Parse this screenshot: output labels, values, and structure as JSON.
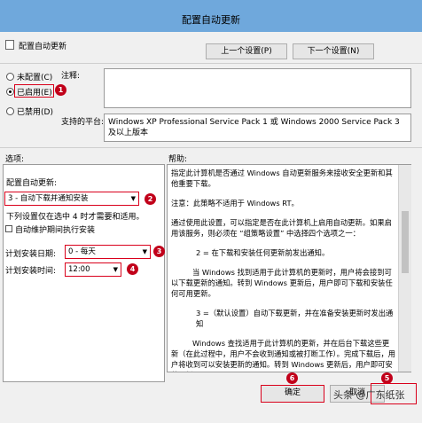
{
  "window": {
    "title": "配置自动更新"
  },
  "header": {
    "policy_name": "配置自动更新",
    "prev_button": "上一个设置(P)",
    "next_button": "下一个设置(N)"
  },
  "state": {
    "options": [
      {
        "label": "未配置(C)",
        "selected": false
      },
      {
        "label": "已启用(E)",
        "selected": true
      },
      {
        "label": "已禁用(D)",
        "selected": false
      }
    ],
    "comment_label": "注释:",
    "platform_label": "支持的平台:",
    "platform_text": "Windows XP Professional Service Pack 1 或 Windows 2000 Service Pack 3 及以上版本"
  },
  "sections": {
    "options_label": "选项:",
    "help_label": "帮助:"
  },
  "options": {
    "configure_label": "配置自动更新:",
    "configure_value": "3 - 自动下载并通知安装",
    "note": "下列设置仅在选中 4 时才需要和适用。",
    "maintenance_checkbox": "自动维护期间执行安装",
    "schedule_day_label": "计划安装日期:",
    "schedule_day_value": "0 - 每天",
    "schedule_time_label": "计划安装时间:",
    "schedule_time_value": "12:00"
  },
  "help": {
    "paragraphs": [
      "指定此计算机是否通过 Windows 自动更新服务来接收安全更新和其他重要下载。",
      "注意：此策略不适用于 Windows RT。",
      "通过使用此设置，可以指定是否在此计算机上启用自动更新。如果启用该服务，则必须在 “组策略设置” 中选择四个选项之一：",
      "2 = 在下载和安装任何更新前发出通知。",
      "当 Windows 找到适用于此计算机的更新时，用户将会接到可以下载更新的通知。转到 Windows 更新后，用户即可下载和安装任何可用更新。",
      "3 =（默认设置）自动下载更新，并在准备安装更新时发出通知",
      "Windows 查找适用于此计算机的更新，并在后台下载这些更新（在此过程中，用户不会收到通知或被打断工作）。完成下载后，用户将收到可以安装更新的通知。转到 Windows 更新后，用户即可安装更新。"
    ]
  },
  "footer": {
    "ok_button": "确定",
    "cancel_button": "取消"
  },
  "watermark": "头条 @广东纸张",
  "annotations": [
    "1",
    "2",
    "3",
    "4",
    "5",
    "6"
  ],
  "colors": {
    "title_bar": "#6fa8dc",
    "marker_red": "#c1001a",
    "window_bg": "#f0f0f0"
  }
}
